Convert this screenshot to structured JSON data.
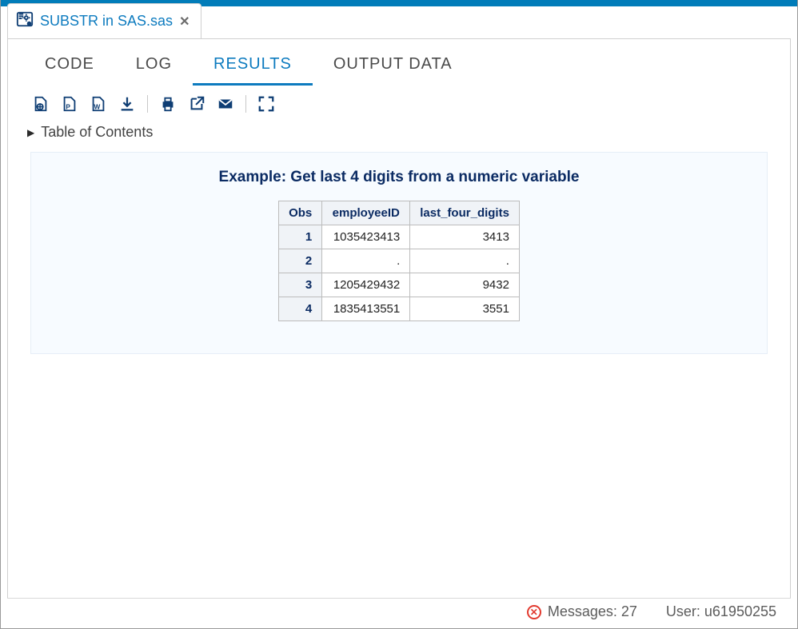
{
  "file_tab": {
    "filename": "SUBSTR in SAS.sas",
    "close_glyph": "✕"
  },
  "subtabs": {
    "code": "CODE",
    "log": "LOG",
    "results": "RESULTS",
    "output": "OUTPUT DATA"
  },
  "toc_label": "Table of Contents",
  "results": {
    "title": "Example: Get last 4 digits from a numeric variable",
    "columns": {
      "obs": "Obs",
      "employeeID": "employeeID",
      "last4": "last_four_digits"
    },
    "rows": [
      {
        "obs": "1",
        "employeeID": "1035423413",
        "last4": "3413"
      },
      {
        "obs": "2",
        "employeeID": ".",
        "last4": "."
      },
      {
        "obs": "3",
        "employeeID": "1205429432",
        "last4": "9432"
      },
      {
        "obs": "4",
        "employeeID": "1835413551",
        "last4": "3551"
      }
    ]
  },
  "status": {
    "messages_label": "Messages: 27",
    "user_label": "User: u61950255"
  },
  "chart_data": {
    "type": "table",
    "title": "Example: Get last 4 digits from a numeric variable",
    "columns": [
      "Obs",
      "employeeID",
      "last_four_digits"
    ],
    "rows": [
      [
        1,
        1035423413,
        3413
      ],
      [
        2,
        null,
        null
      ],
      [
        3,
        1205429432,
        9432
      ],
      [
        4,
        1835413551,
        3551
      ]
    ]
  }
}
